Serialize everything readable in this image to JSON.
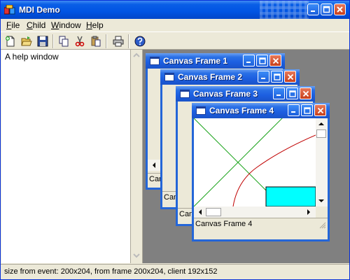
{
  "window": {
    "title": "MDI Demo",
    "colors": {
      "titlebar": "#0054e3",
      "face": "#ece9d8",
      "mdi_background": "#808080",
      "close": "#c8401c"
    }
  },
  "menu": {
    "items": [
      {
        "label": "File",
        "mnemonic": "F",
        "rest": "ile"
      },
      {
        "label": "Child",
        "mnemonic": "C",
        "rest": "hild"
      },
      {
        "label": "Window",
        "mnemonic": "W",
        "rest": "indow"
      },
      {
        "label": "Help",
        "mnemonic": "H",
        "rest": "elp"
      }
    ]
  },
  "toolbar": {
    "buttons": [
      {
        "icon": "new-icon"
      },
      {
        "icon": "open-icon"
      },
      {
        "icon": "save-icon"
      },
      {
        "icon": "copy-icon"
      },
      {
        "icon": "cut-icon"
      },
      {
        "icon": "paste-icon"
      },
      {
        "icon": "print-icon"
      },
      {
        "icon": "help-icon"
      }
    ]
  },
  "help_pane": {
    "text": "A help window"
  },
  "children": [
    {
      "title": "Canvas Frame 1",
      "status": "Canvas Frame 1"
    },
    {
      "title": "Canvas Frame 2",
      "status": "Canvas Frame 2"
    },
    {
      "title": "Canvas Frame 3",
      "status": "Canvas Frame 3"
    },
    {
      "title": "Canvas Frame 4",
      "status": "Canvas Frame 4"
    }
  ],
  "canvas": {
    "rect_color": "#00ffff",
    "line_color": "#008000",
    "curve_color": "#c00000"
  },
  "statusbar": {
    "text": "size from event: 200x204, from frame 200x204, client 192x152"
  }
}
